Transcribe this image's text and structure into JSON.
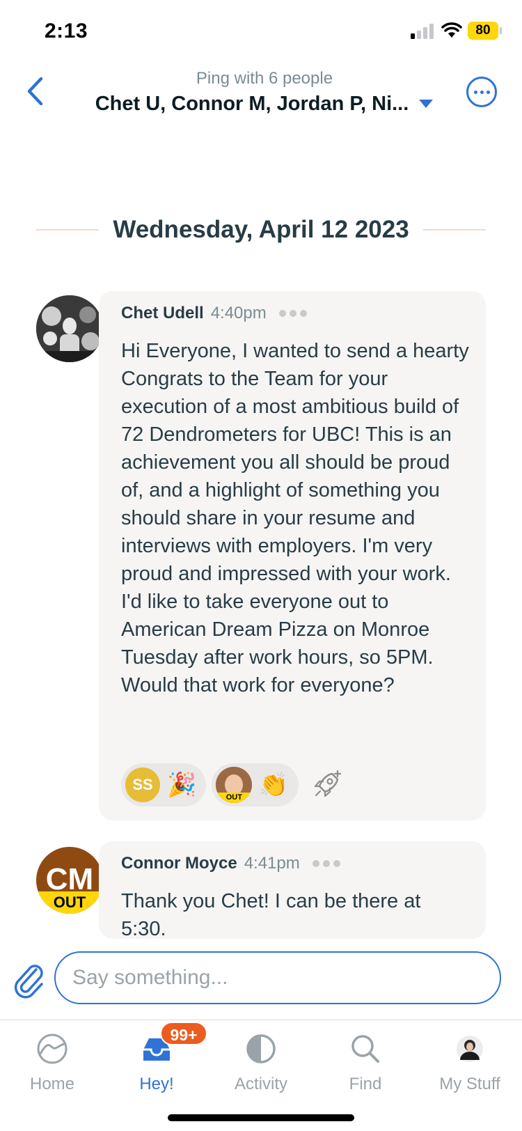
{
  "status_bar": {
    "time": "2:13",
    "battery": "80"
  },
  "header": {
    "subtitle": "Ping with 6 people",
    "title": "Chet U, Connor M, Jordan P, Ni..."
  },
  "date_divider": "Wednesday, April 12 2023",
  "messages": [
    {
      "author": "Chet Udell",
      "time": "4:40pm",
      "body": "Hi Everyone, I wanted to send a hearty Congrats to the Team for your execution of a most ambitious build of 72 Dendrometers for UBC! This is an achievement you all should be proud of, and a highlight of something you should share in your resume and interviews with employers. I'm very proud and impressed with your work. I'd like to take everyone out to American Dream Pizza on Monroe Tuesday after work hours, so 5PM. Would that work for everyone?",
      "boosts": [
        {
          "initials": "SS",
          "emoji": "🎉"
        },
        {
          "status": "OUT",
          "emoji": "👏"
        }
      ]
    },
    {
      "author": "Connor Moyce",
      "time": "4:41pm",
      "avatar_initials": "CM",
      "avatar_status": "OUT",
      "body": "Thank you Chet! I can be there at 5:30."
    }
  ],
  "composer": {
    "placeholder": "Say something..."
  },
  "tabs": [
    {
      "label": "Home",
      "icon": "home-icon"
    },
    {
      "label": "Hey!",
      "icon": "hey-inbox-icon",
      "badge": "99+"
    },
    {
      "label": "Activity",
      "icon": "activity-icon"
    },
    {
      "label": "Find",
      "icon": "search-icon"
    },
    {
      "label": "My Stuff",
      "icon": "profile-icon"
    }
  ],
  "colors": {
    "accent": "#2e73d6",
    "badge": "#ec5c1e",
    "out": "#ffd60a",
    "bubble": "#f6f5f3"
  }
}
